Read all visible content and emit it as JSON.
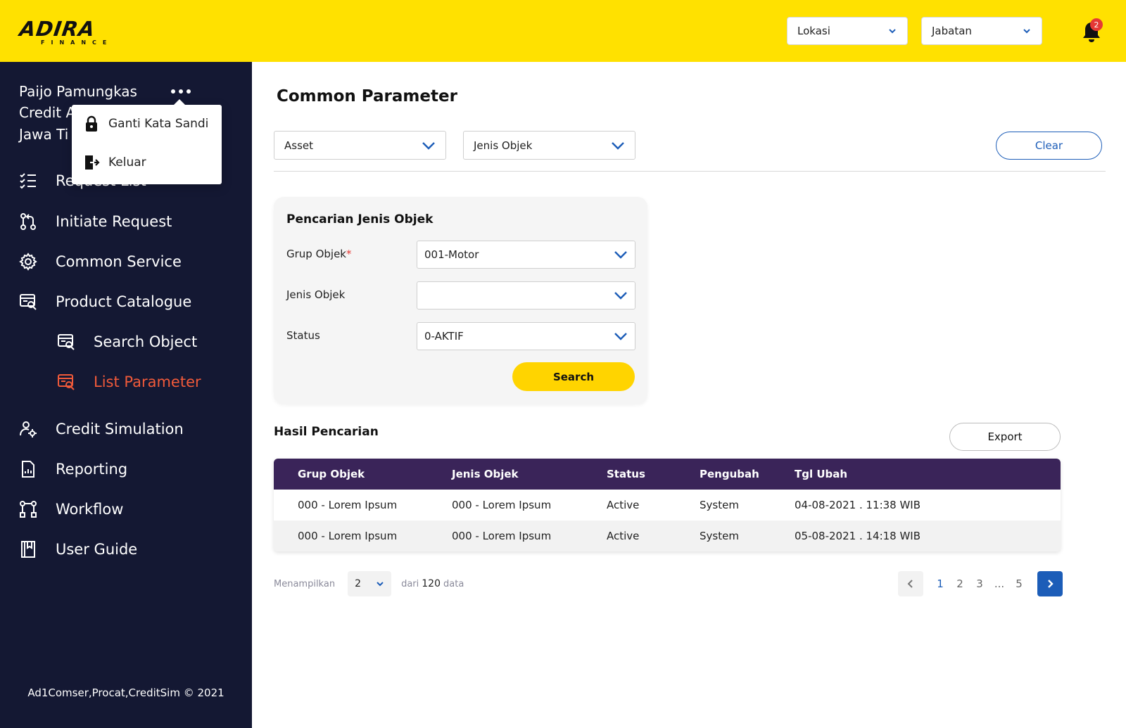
{
  "brand": {
    "logo_main": "ADIRA",
    "logo_sub": "FINANCE"
  },
  "header": {
    "location_select": "Lokasi",
    "position_select": "Jabatan",
    "notification_count": "2"
  },
  "user": {
    "name": "Paijo Pamungkas",
    "role_partial": "Credit A",
    "region_partial": "Jawa Ti"
  },
  "user_menu": {
    "items": [
      {
        "label": "Ganti Kata Sandi",
        "icon": "lock-icon"
      },
      {
        "label": "Keluar",
        "icon": "logout-icon"
      }
    ]
  },
  "sidebar": {
    "items": [
      {
        "label": "Request List",
        "icon": "checklist-icon"
      },
      {
        "label": "Initiate Request",
        "icon": "pull-request-icon"
      },
      {
        "label": "Common Service",
        "icon": "gear-icon"
      },
      {
        "label": "Product Catalogue",
        "icon": "catalogue-search-icon"
      },
      {
        "label": "Search Object",
        "icon": "catalogue-search-icon"
      },
      {
        "label": "List Parameter",
        "icon": "catalogue-search-icon",
        "active": true
      },
      {
        "label": "Credit Simulation",
        "icon": "user-gear-icon"
      },
      {
        "label": "Reporting",
        "icon": "report-icon"
      },
      {
        "label": "Workflow",
        "icon": "workflow-icon"
      },
      {
        "label": "User Guide",
        "icon": "book-icon"
      }
    ],
    "footer": "Ad1Comser,Procat,CreditSim © 2021"
  },
  "page": {
    "title": "Common Parameter",
    "filter_asset": "Asset",
    "filter_jenis": "Jenis Objek",
    "clear_label": "Clear"
  },
  "search_card": {
    "title": "Pencarian Jenis Objek",
    "grup_label": "Grup Objek",
    "grup_required": "*",
    "grup_value": "001-Motor",
    "jenis_label": "Jenis Objek",
    "jenis_value": "",
    "status_label": "Status",
    "status_value": "0-AKTIF",
    "search_label": "Search"
  },
  "results": {
    "title": "Hasil Pencarian",
    "export_label": "Export",
    "columns": [
      "Grup Objek",
      "Jenis Objek",
      "Status",
      "Pengubah",
      "Tgl Ubah"
    ],
    "rows": [
      [
        "000 - Lorem Ipsum",
        "000 - Lorem Ipsum",
        "Active",
        "System",
        "04-08-2021 . 11:38 WIB"
      ],
      [
        "000 - Lorem Ipsum",
        "000 - Lorem Ipsum",
        "Active",
        "System",
        "05-08-2021 . 14:18 WIB"
      ]
    ]
  },
  "pagination": {
    "showing_label": "Menampilkan",
    "page_size": "2",
    "of_label": "dari",
    "total": "120",
    "data_label": "data",
    "pages": [
      "1",
      "2",
      "3",
      "...",
      "5"
    ],
    "current_page": "1"
  },
  "colors": {
    "header_bg": "#FFE100",
    "sidebar_bg": "#141833",
    "active_nav": "#F15A3A",
    "table_header": "#3A2459",
    "primary_blue": "#1C5DB8",
    "search_button": "#FFD400"
  }
}
